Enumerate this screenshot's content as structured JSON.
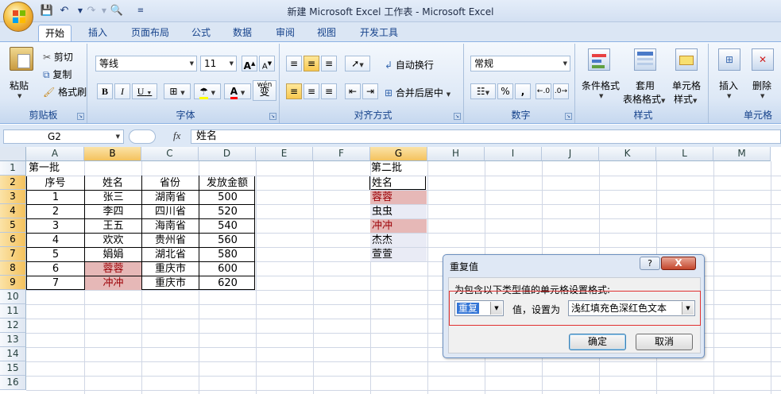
{
  "window": {
    "title": "新建 Microsoft Excel 工作表 - Microsoft Excel"
  },
  "tabs": [
    "开始",
    "插入",
    "页面布局",
    "公式",
    "数据",
    "审阅",
    "视图",
    "开发工具"
  ],
  "active_tab": "开始",
  "ribbon": {
    "clipboard": {
      "paste": "粘贴",
      "cut": "剪切",
      "copy": "复制",
      "format_painter": "格式刷",
      "label": "剪贴板"
    },
    "font": {
      "name": "等线",
      "size": "11",
      "grow": "A",
      "shrink": "A",
      "bold": "B",
      "italic": "I",
      "underline": "U",
      "phonetic": "wén",
      "phonetic_char": "变",
      "label": "字体"
    },
    "alignment": {
      "wrap": "自动换行",
      "merge": "合并后居中",
      "label": "对齐方式"
    },
    "number": {
      "format": "常规",
      "percent": "%",
      "comma": ",",
      "label": "数字"
    },
    "styles": {
      "conditional": "条件格式",
      "table_1": "套用",
      "table_2": "表格格式",
      "cell_1": "单元格",
      "cell_2": "样式",
      "label": "样式"
    },
    "cells": {
      "insert": "插入",
      "delete": "删除",
      "label": "单元格"
    }
  },
  "formula_bar": {
    "name_box": "G2",
    "fx": "fx",
    "content": "姓名"
  },
  "columns": [
    "A",
    "B",
    "C",
    "D",
    "E",
    "F",
    "G",
    "H",
    "I",
    "J",
    "K",
    "L",
    "M"
  ],
  "rows": [
    "1",
    "2",
    "3",
    "4",
    "5",
    "6",
    "7",
    "8",
    "9",
    "10",
    "11",
    "12",
    "13",
    "14",
    "15",
    "16"
  ],
  "sheet": {
    "batch1_title": "第一批",
    "batch1_headers": [
      "序号",
      "姓名",
      "省份",
      "发放金额"
    ],
    "batch1_rows": [
      [
        "1",
        "张三",
        "湖南省",
        "500"
      ],
      [
        "2",
        "李四",
        "四川省",
        "520"
      ],
      [
        "3",
        "王五",
        "海南省",
        "540"
      ],
      [
        "4",
        "欢欢",
        "贵州省",
        "560"
      ],
      [
        "5",
        "娟娟",
        "湖北省",
        "580"
      ],
      [
        "6",
        "蓉蓉",
        "重庆市",
        "600"
      ],
      [
        "7",
        "冲冲",
        "重庆市",
        "620"
      ]
    ],
    "batch2_title": "第二批",
    "batch2_header": "姓名",
    "batch2_names": [
      "蓉蓉",
      "虫虫",
      "冲冲",
      "杰杰",
      "萱萱"
    ]
  },
  "dialog": {
    "title": "重复值",
    "help": "?",
    "close": "X",
    "prompt": "为包含以下类型值的单元格设置格式:",
    "type_value": "重复",
    "mid_text": "值，设置为",
    "format_value": "浅红填充色深红色文本",
    "ok": "确定",
    "cancel": "取消"
  },
  "colors": {
    "duplicate_fill": "#e6b8b7",
    "duplicate_text": "#9c0006",
    "accent": "#15428b"
  }
}
